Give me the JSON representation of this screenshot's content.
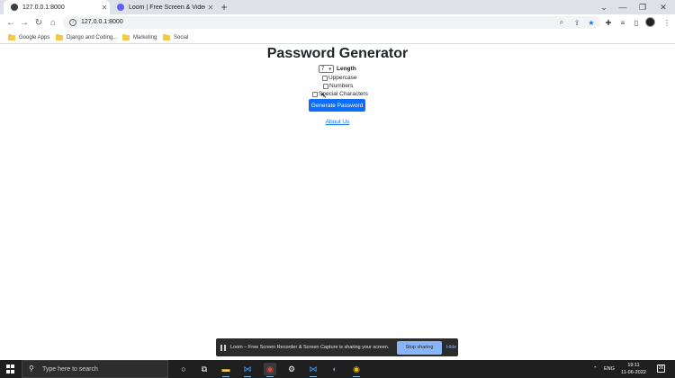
{
  "browser": {
    "tabs": [
      {
        "title": "127.0.0.1:8000",
        "favicon_color": "#3c4043",
        "active": true
      },
      {
        "title": "Loom | Free Screen & Video Rec",
        "favicon_color": "#625df5",
        "active": false
      }
    ],
    "url": "127.0.0.1:8000",
    "bookmarks": [
      {
        "label": "Google Apps"
      },
      {
        "label": "Django and Coding..."
      },
      {
        "label": "Marketing"
      },
      {
        "label": "Social"
      }
    ]
  },
  "page": {
    "title": "Password Generator",
    "length_value": "7",
    "length_label": "Length",
    "options": [
      {
        "label": "Uppercase",
        "checked": false
      },
      {
        "label": "Numbers",
        "checked": false
      },
      {
        "label": "Special Characters",
        "checked": false
      }
    ],
    "generate_label": "Generate Password",
    "about_label": "About Us"
  },
  "sharing_bar": {
    "message": "Loom – Free Screen Recorder & Screen Capture is sharing your screen.",
    "stop_label": "Stop sharing",
    "hide_label": "Hide"
  },
  "taskbar": {
    "search_placeholder": "Type here to search",
    "language": "ENG",
    "time": "19:11",
    "date": "11-06-2022",
    "notification_count": "26"
  },
  "colors": {
    "primary_button": "#0d6efd",
    "taskbar": "#1f1f1f",
    "share_stop": "#8ab4f8"
  }
}
